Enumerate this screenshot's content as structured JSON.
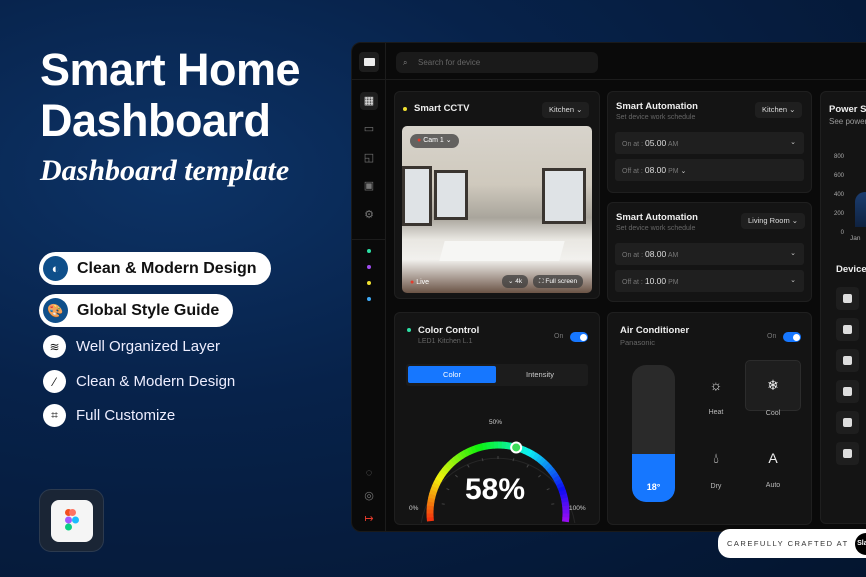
{
  "hero": {
    "title_line1": "Smart Home",
    "title_line2": "Dashboard",
    "subtitle": "Dashboard template"
  },
  "features": [
    {
      "label": "Clean & Modern Design",
      "icon": "contrast-icon",
      "highlight": true
    },
    {
      "label": "Global Style Guide",
      "icon": "palette-icon",
      "highlight": true
    },
    {
      "label": "Well Organized Layer",
      "icon": "layers-icon",
      "highlight": false
    },
    {
      "label": "Clean & Modern Design",
      "icon": "magic-wand-icon",
      "highlight": false
    },
    {
      "label": "Full Customize",
      "icon": "crop-icon",
      "highlight": false
    }
  ],
  "search": {
    "placeholder": "Search for device"
  },
  "sidebar": {
    "status_dots": [
      "#2de0a5",
      "#a04df0",
      "#f0e030",
      "#3fa9f5"
    ]
  },
  "cctv": {
    "title": "Smart CCTV",
    "room": "Kitchen",
    "camera": "Cam 1",
    "live": "Live",
    "quality": "4k",
    "fullscreen": "Full screen"
  },
  "automation": [
    {
      "title": "Smart Automation",
      "subtitle": "Set device work schedule",
      "room": "Kitchen",
      "on_label": "On at :",
      "on_time": "05.00",
      "on_period": "AM",
      "off_label": "Off at :",
      "off_time": "08.00",
      "off_period": "PM"
    },
    {
      "title": "Smart Automation",
      "subtitle": "Set device work schedule",
      "room": "Living Room",
      "on_label": "On at :",
      "on_time": "08.00",
      "on_period": "AM",
      "off_label": "Off at :",
      "off_time": "10.00",
      "off_period": "PM"
    }
  ],
  "power": {
    "title": "Power St",
    "subtitle": "See power e",
    "y_ticks": [
      "800",
      "600",
      "400",
      "200",
      "0"
    ],
    "x_first": "Jan",
    "devices_title": "Device"
  },
  "color_control": {
    "title": "Color Control",
    "device": "LED1 Kitchen L.1",
    "toggle_label": "On",
    "toggle_on": true,
    "tabs": [
      "Color",
      "Intensity"
    ],
    "active_tab": "Color",
    "value_label": "58%",
    "value": 58,
    "min_label": "0%",
    "mid_label": "50%",
    "max_label": "100%"
  },
  "ac": {
    "title": "Air Conditioner",
    "brand": "Panasonic",
    "toggle_label": "On",
    "toggle_on": true,
    "temperature": "18°",
    "level_percent": 35,
    "modes": [
      {
        "label": "Heat",
        "icon": "sun-icon"
      },
      {
        "label": "Cool",
        "icon": "snowflake-icon",
        "active": true
      },
      {
        "label": "Dry",
        "icon": "droplet-icon"
      },
      {
        "label": "Auto",
        "icon": "auto-a-icon"
      }
    ]
  },
  "credit": {
    "text": "CAREFULLY CRAFTED AT",
    "logo": "Slab!"
  },
  "colors": {
    "accent": "#1677ff",
    "panel": "#0a0a0a",
    "card": "#141414"
  }
}
